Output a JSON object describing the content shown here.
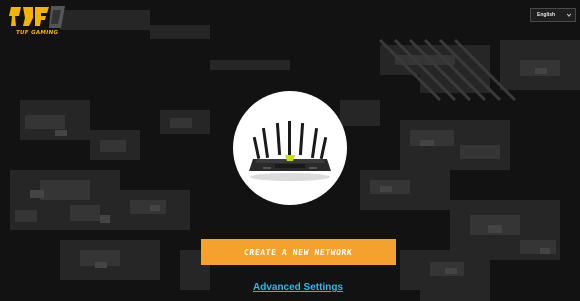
{
  "header": {
    "logo_text": "TUF GAMING",
    "language": {
      "selected": "English",
      "icon": "chevron-down-icon"
    }
  },
  "hero": {
    "image": "router-image"
  },
  "actions": {
    "create_network_label": "CREATE A NEW NETWORK",
    "advanced_settings_label": "Advanced Settings"
  },
  "colors": {
    "background": "#121212",
    "camo_light": "#3a3a3a",
    "camo_mid": "#262626",
    "accent_orange": "#f4a22d",
    "link_blue": "#2fb8e8",
    "logo_yellow": "#f4b400"
  }
}
